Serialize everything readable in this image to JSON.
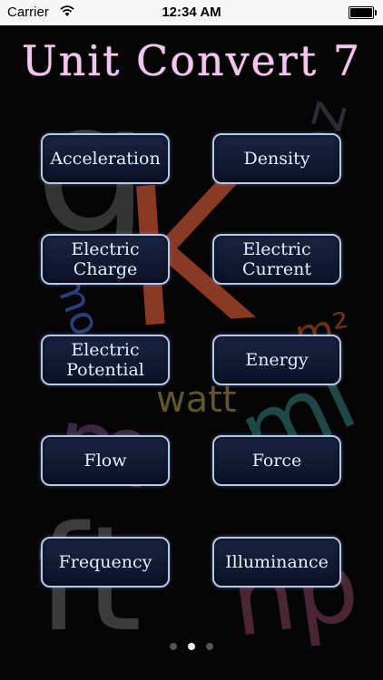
{
  "status": {
    "carrier": "Carrier",
    "time": "12:34 AM"
  },
  "app": {
    "title": "Unit Convert 7"
  },
  "background_glyphs": [
    {
      "text": "g",
      "color": "#3a3a3a"
    },
    {
      "text": "K",
      "color": "#8a3a24"
    },
    {
      "text": "oz",
      "color": "#2a2d33"
    },
    {
      "text": "mo",
      "color": "#2b3e7a"
    },
    {
      "text": "m²",
      "color": "#6a3219"
    },
    {
      "text": "watt",
      "color": "#5d5630"
    },
    {
      "text": "m",
      "color": "#3a2840"
    },
    {
      "text": "mi",
      "color": "#1f4746"
    },
    {
      "text": "ft",
      "color": "#3b3b3b"
    },
    {
      "text": "hp",
      "color": "#4a2635"
    }
  ],
  "buttons": [
    {
      "line1": "Acceleration",
      "line2": ""
    },
    {
      "line1": "Density",
      "line2": ""
    },
    {
      "line1": "Electric",
      "line2": "Charge"
    },
    {
      "line1": "Electric",
      "line2": "Current"
    },
    {
      "line1": "Electric",
      "line2": "Potential"
    },
    {
      "line1": "Energy",
      "line2": ""
    },
    {
      "line1": "Flow",
      "line2": ""
    },
    {
      "line1": "Force",
      "line2": ""
    },
    {
      "line1": "Frequency",
      "line2": ""
    },
    {
      "line1": "Illuminance",
      "line2": ""
    }
  ],
  "page_control": {
    "pages": 3,
    "current": 2
  }
}
